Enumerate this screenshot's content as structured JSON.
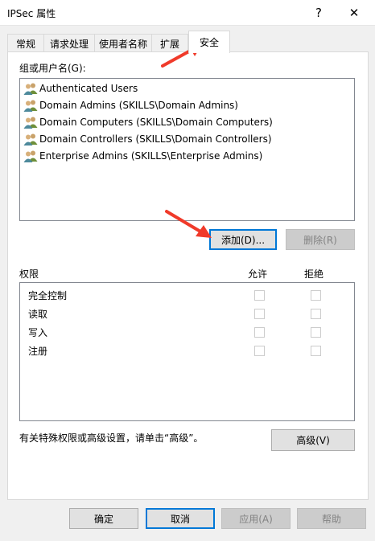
{
  "window": {
    "title": "IPSec 属性",
    "help_glyph": "?",
    "close_glyph": "✕"
  },
  "tabs": [
    {
      "label": "常规",
      "active": false
    },
    {
      "label": "请求处理",
      "active": false
    },
    {
      "label": "使用者名称",
      "active": false
    },
    {
      "label": "扩展",
      "active": false
    },
    {
      "label": "安全",
      "active": true
    }
  ],
  "security": {
    "groups_label": "组或用户名(G):",
    "users": [
      "Authenticated Users",
      "Domain Admins (SKILLS\\Domain Admins)",
      "Domain Computers (SKILLS\\Domain Computers)",
      "Domain Controllers (SKILLS\\Domain Controllers)",
      "Enterprise Admins (SKILLS\\Enterprise Admins)"
    ],
    "add_label": "添加(D)...",
    "remove_label": "删除(R)",
    "permissions_label": "权限",
    "allow_label": "允许",
    "deny_label": "拒绝",
    "permissions": [
      {
        "name": "完全控制",
        "allow": false,
        "deny": false
      },
      {
        "name": "读取",
        "allow": false,
        "deny": false
      },
      {
        "name": "写入",
        "allow": false,
        "deny": false
      },
      {
        "name": "注册",
        "allow": false,
        "deny": false
      }
    ],
    "advanced_hint": "有关特殊权限或高级设置，请单击“高级”。",
    "advanced_label": "高级(V)"
  },
  "footer": {
    "ok_label": "确定",
    "cancel_label": "取消",
    "apply_label": "应用(A)",
    "help_label": "帮助"
  },
  "colors": {
    "annotation_arrow": "#f03a2a",
    "focus_border": "#0078d7"
  }
}
